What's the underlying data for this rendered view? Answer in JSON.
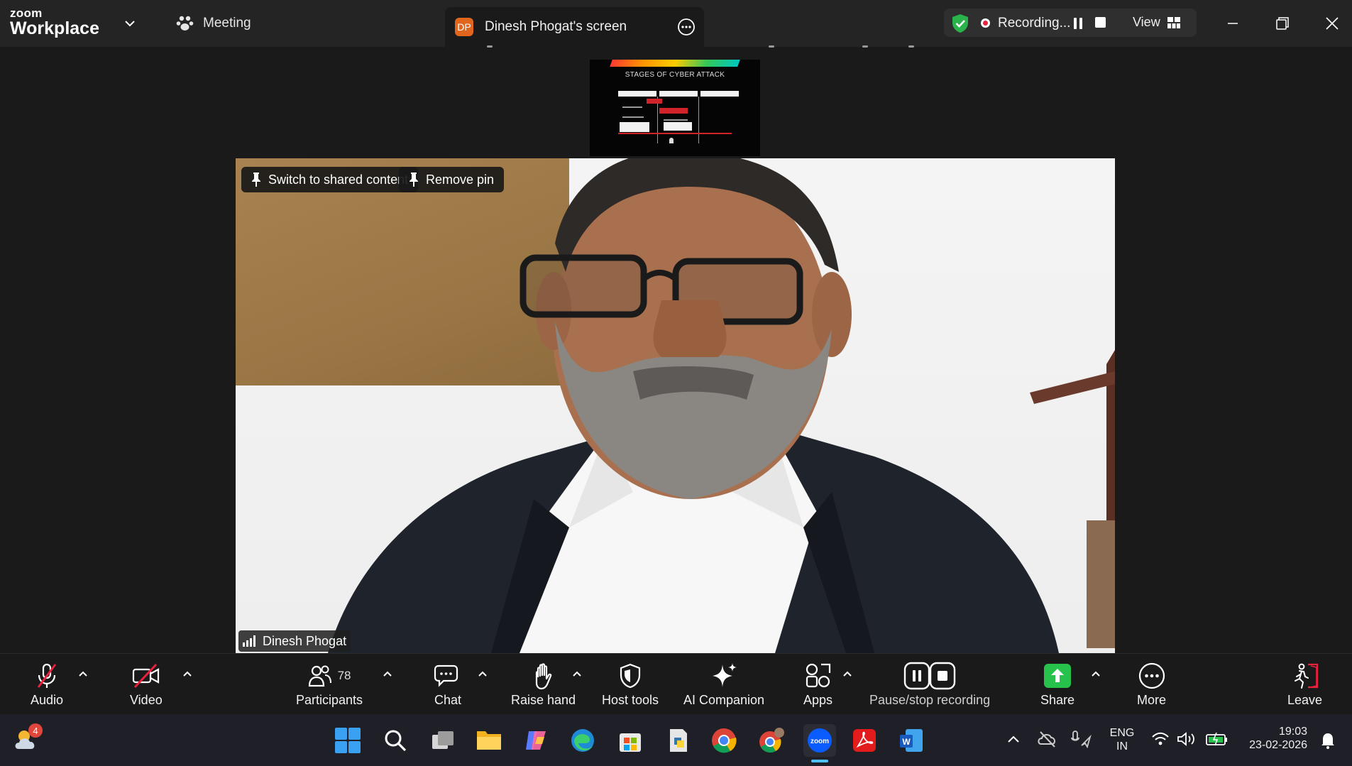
{
  "app": {
    "brand_small": "zoom",
    "brand_large": "Workplace",
    "meeting_label": "Meeting",
    "tab_initials": "DP",
    "tab_title": "Dinesh Phogat's screen"
  },
  "recording": {
    "status_text": "Recording...",
    "view_label": "View"
  },
  "shared_thumbnail": {
    "title": "STAGES OF CYBER ATTACK"
  },
  "video": {
    "switch_button": "Switch to shared content",
    "remove_pin_button": "Remove pin",
    "participant_name": "Dinesh Phogat"
  },
  "toolbar": {
    "audio": "Audio",
    "video": "Video",
    "participants": "Participants",
    "participants_count": "78",
    "chat": "Chat",
    "raise_hand": "Raise hand",
    "host_tools": "Host tools",
    "ai_companion": "AI Companion",
    "apps": "Apps",
    "pause_stop_recording": "Pause/stop recording",
    "share": "Share",
    "more": "More",
    "leave": "Leave"
  },
  "taskbar": {
    "weather_badge": "4",
    "language": "ENG",
    "region": "IN",
    "time": "19:03",
    "date": "23-02-2026"
  },
  "colors": {
    "share_green": "#27c24c",
    "record_red": "#e8213d",
    "leave_red": "#e8213d",
    "shield_green": "#2ab24b"
  }
}
